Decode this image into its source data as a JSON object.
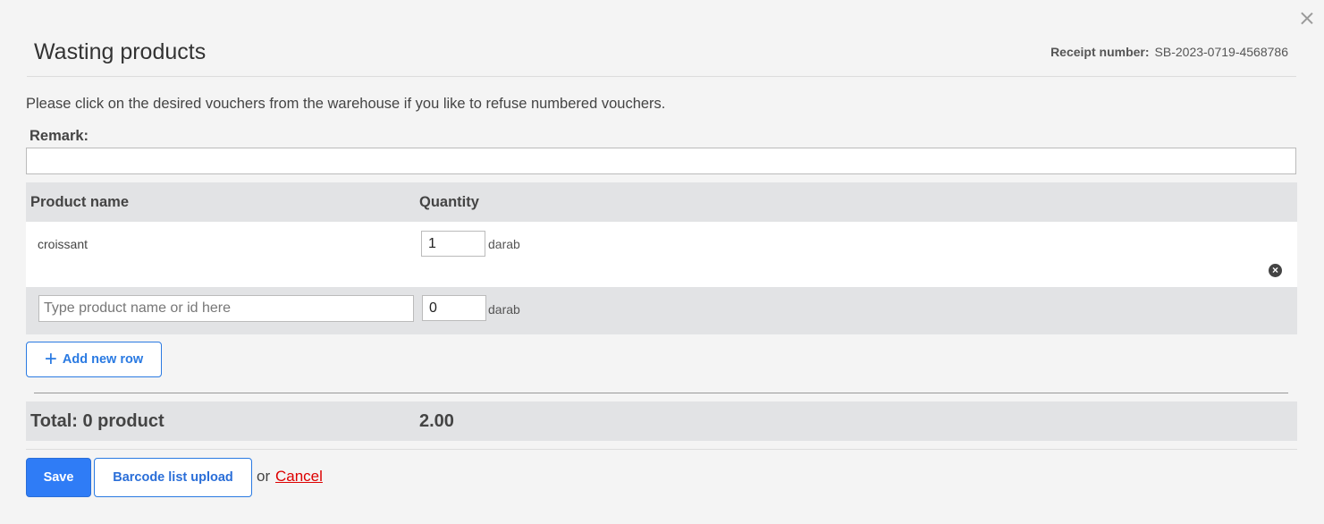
{
  "header": {
    "title": "Wasting products",
    "receipt_label": "Receipt number:",
    "receipt_value": "SB-2023-0719-4568786"
  },
  "intro_text": "Please click on the desired vouchers from the warehouse if you like to refuse numbered vouchers.",
  "remark": {
    "label": "Remark:",
    "value": ""
  },
  "table": {
    "columns": [
      "Product name",
      "Quantity"
    ],
    "rows": [
      {
        "product": "croissant",
        "quantity": "1",
        "unit": "darab"
      }
    ],
    "new_row": {
      "placeholder": "Type product name or id here",
      "quantity": "0",
      "unit": "darab"
    }
  },
  "add_row_label": "Add new row",
  "total": {
    "label": "Total: 0 product",
    "value": "2.00"
  },
  "footer": {
    "save_label": "Save",
    "barcode_label": "Barcode list upload",
    "or_text": "or",
    "cancel_label": "Cancel"
  },
  "colors": {
    "primary": "#2f7cf6",
    "cancel": "#dd0000",
    "table_header_bg": "#e2e3e5"
  },
  "icons": {
    "close": "close-icon",
    "remove": "remove-row-icon",
    "add": "plus-icon"
  }
}
